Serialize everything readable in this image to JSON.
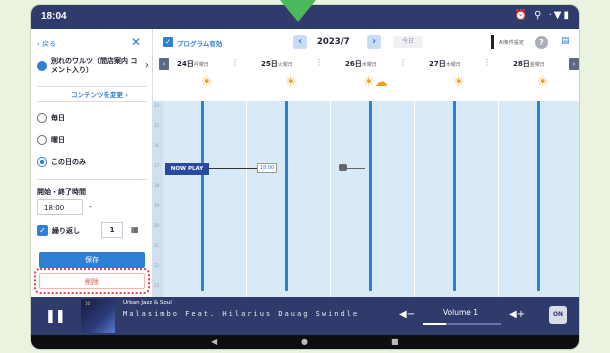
{
  "statusbar": {
    "time": "18:04",
    "icons": "⏰ ⚲ ·▼▮"
  },
  "panel": {
    "back_label": "‹ 戻る",
    "close": "✕",
    "program_title": "別れのワルツ（間店案内 コメント入り）",
    "change_contents": "コンテンツを変更 ›",
    "radio_options": [
      {
        "label": "毎日",
        "selected": false
      },
      {
        "label": "曜日",
        "selected": false
      },
      {
        "label": "この日のみ",
        "selected": true
      }
    ],
    "time_label": "開始・終了時間",
    "start_time": "18:00",
    "time_separator": "-",
    "repeat_label": "繰り返し",
    "repeat_count": "1",
    "save_label": "保存",
    "delete_label": "削除"
  },
  "calendar": {
    "program_checkbox_label": "プログラム有効",
    "month": "2023/7",
    "today_label": "今日",
    "settings_label": "AI条件設定",
    "help": "?",
    "days": [
      {
        "date": "24日",
        "weekday": "月曜日",
        "weather": "☀"
      },
      {
        "date": "25日",
        "weekday": "火曜日",
        "weather": "☀"
      },
      {
        "date": "26日",
        "weekday": "水曜日",
        "weather": "☀☁"
      },
      {
        "date": "27日",
        "weekday": "木曜日",
        "weather": "☀"
      },
      {
        "date": "28日",
        "weekday": "金曜日",
        "weather": "☀"
      }
    ],
    "hours": [
      "14",
      "15",
      "16",
      "17",
      "18",
      "19",
      "20",
      "21",
      "22",
      "23"
    ],
    "now_play_label": "NOW PLAY",
    "time_chip": "18:00"
  },
  "player": {
    "thumb_caption": "10",
    "genre": "Urban Jazz & Soul",
    "track": "Malasimbo Feat. Hilarius Dauag Swindle",
    "volume_label": "Volume 1",
    "volume_level": 0.3,
    "radio_icon": "ON"
  },
  "colors": {
    "accent": "#2f7fd4",
    "header": "#2f3b6b",
    "delete": "#d9534f",
    "grid": "#d8eaf8"
  }
}
